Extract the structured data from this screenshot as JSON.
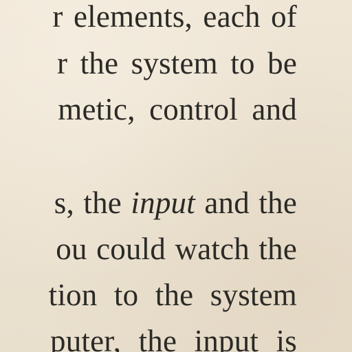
{
  "page": {
    "paper_color": "#ece3d3",
    "ink_color": "#2b2a26",
    "lines": [
      "r elements, each of",
      "r the system to be",
      "metic, control and",
      "",
      "s, the input and the",
      "ou could watch the",
      "tion to the system",
      "puter, the input is"
    ],
    "line4_parts": {
      "pre": "s, the ",
      "emphasis": "input",
      "post": " and the"
    }
  }
}
